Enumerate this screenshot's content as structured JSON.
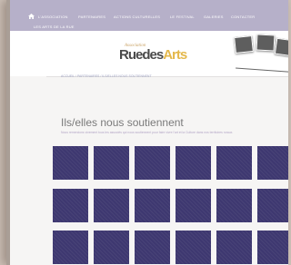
{
  "nav": {
    "items": [
      "L'ASSOCIATION",
      "PARTENAIRES",
      "ACTIONS CULTURELLES",
      "LE FESTIVAL",
      "GALERIES",
      "CONTACTER",
      "LES ARTS DE LA RUE"
    ]
  },
  "logo": {
    "small": "Association",
    "big_prefix": "Ruedes",
    "big_accent": "Arts"
  },
  "breadcrumb": {
    "home": "ACCUEIL",
    "parent": "PARTENAIRES",
    "current": "ILS/ELLES NOUS SOUTIENNENT"
  },
  "page": {
    "title": "Ils/elles nous soutiennent",
    "description": "Nous remercions vivement tous les associés qui nous soutiennent pour faire vivre l'art et la Culture dans nos territoires ruraux."
  },
  "colors": {
    "nav_bg": "#b6b0c9",
    "tile": "#3e3870",
    "logo_accent": "#e4b84b"
  }
}
